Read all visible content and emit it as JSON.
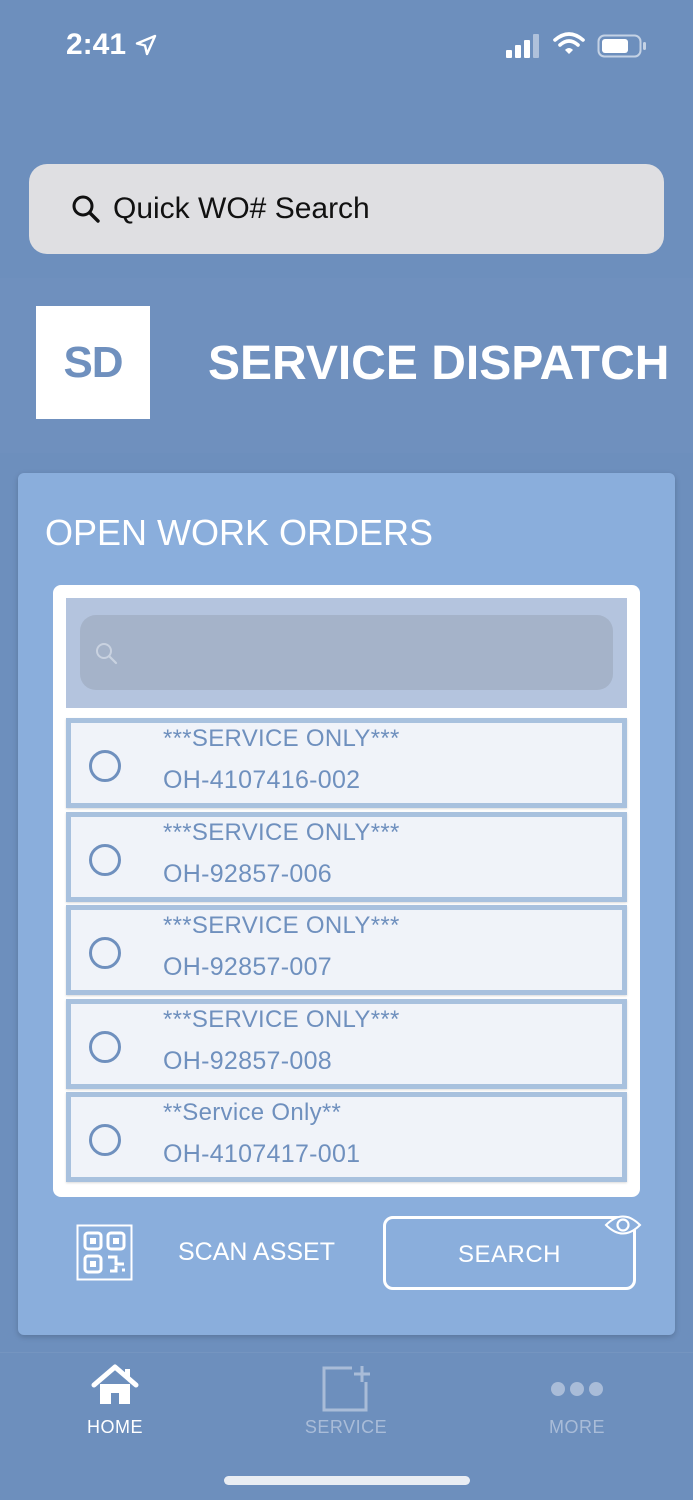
{
  "status_bar": {
    "time": "2:41",
    "icons": [
      "location-arrow-icon",
      "cellular-signal-icon",
      "wifi-icon",
      "battery-icon"
    ]
  },
  "quick_search": {
    "placeholder": "Quick WO# Search",
    "icon": "search-icon"
  },
  "brand": {
    "logo_text": "SD",
    "title": "SERVICE DISPATCH"
  },
  "work_orders": {
    "title": "OPEN WORK ORDERS",
    "filter_placeholder": "",
    "items": [
      {
        "line1": "***SERVICE ONLY***",
        "line2": "OH-4107416-002",
        "selected": false
      },
      {
        "line1": "***SERVICE ONLY***",
        "line2": "OH-92857-006",
        "selected": false
      },
      {
        "line1": "***SERVICE ONLY***",
        "line2": "OH-92857-007",
        "selected": false
      },
      {
        "line1": "***SERVICE ONLY***",
        "line2": "OH-92857-008",
        "selected": false
      },
      {
        "line1": "**Service Only**",
        "line2": "OH-4107417-001",
        "selected": false
      }
    ]
  },
  "actions": {
    "scan_label": "SCAN ASSET",
    "search_label": "SEARCH"
  },
  "tabs": [
    {
      "label": "HOME",
      "icon": "home-icon",
      "active": true
    },
    {
      "label": "SERVICE",
      "icon": "add-square-icon",
      "active": false
    },
    {
      "label": "MORE",
      "icon": "more-dots-icon",
      "active": false
    }
  ],
  "colors": {
    "background": "#6d8fbd",
    "card": "#8aaedc",
    "accent": "#6f90be",
    "item_border": "#a8c1de"
  }
}
